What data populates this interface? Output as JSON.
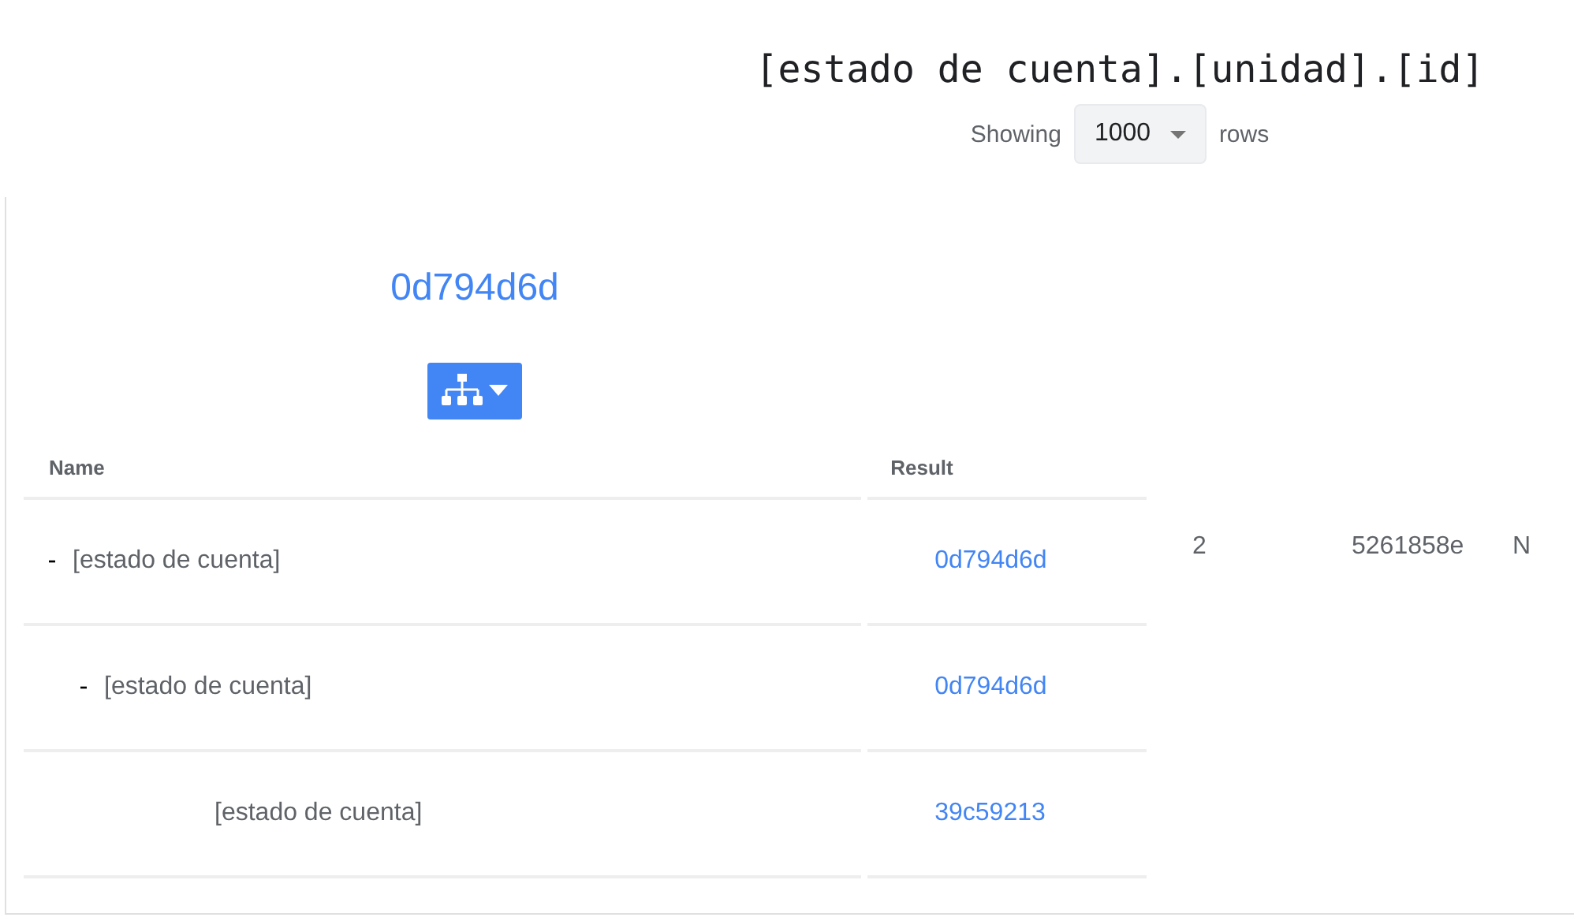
{
  "title": "[estado de cuenta].[unidad].[id]",
  "row_count": {
    "prefix": "Showing",
    "value": "1000",
    "suffix": "rows"
  },
  "root_link": "0d794d6d",
  "columns": [
    "Name",
    "Result"
  ],
  "tree": [
    {
      "name": "[estado de cuenta]",
      "result": "0d794d6d",
      "expanded": true,
      "children": [
        {
          "name": "[estado de cuenta]",
          "result": "0d794d6d",
          "expanded": true,
          "children": [
            {
              "name": "[estado de cuenta]",
              "result": "39c59213"
            }
          ]
        }
      ]
    }
  ],
  "extra_values": [
    "2",
    "5261858e",
    "N"
  ]
}
